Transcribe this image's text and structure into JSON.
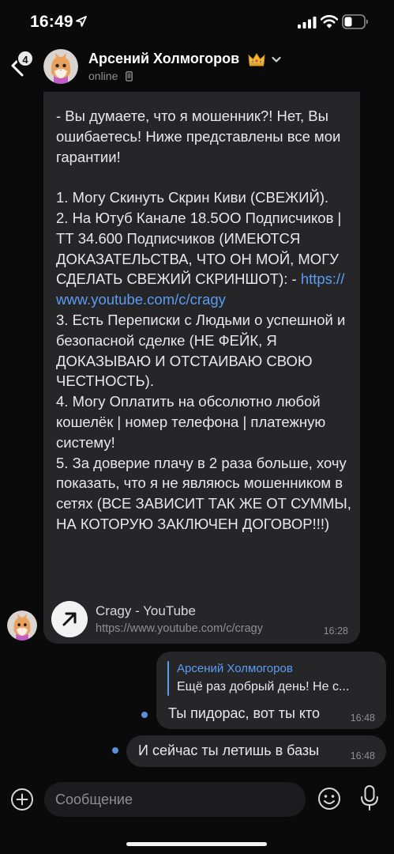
{
  "status_bar": {
    "time": "16:49"
  },
  "header": {
    "back_badge": "4",
    "contact_name": "Арсений Холмогоров",
    "status": "online"
  },
  "messages": {
    "incoming": {
      "text_before_link": "- Вы думаете, что я мошенник?! Нет, Вы ошибаетесь! Ниже представлены все мои гарантии!\n\n1. Могу Скинуть Скрин Киви (СВЕЖИЙ).\n2. На Ютуб Канале 18.5OO Подписчиков | ТТ 34.600 Подписчиков (ИМЕЮТСЯ ДОКАЗАТЕЛЬСТВА, ЧТО ОН МОЙ, МОГУ СДЕЛАТЬ СВЕЖИЙ СКРИНШОТ): - ",
      "link": "https://\nwww.youtube.com/c/cragy",
      "text_after_link": "\n3. Есть Переписки с Людьми о успешной и безопасной сделке (НЕ ФЕЙК, Я ДОКАЗЫВАЮ И ОТСТАИВАЮ СВОЮ ЧЕСТНОСТЬ).\n4. Могу Оплатить на обсолютно любой кошелёк | номер телефона | платежную систему!\n5. За доверие плачу в 2 раза больше, хочу показать, что я не являюсь мошенником в сетях (ВСЕ ЗАВИСИТ ТАК ЖЕ ОТ СУММЫ, НА КОТОРУЮ ЗАКЛЮЧЕН ДОГОВОР!!!)",
      "preview_title": "Cragy - YouTube",
      "preview_url": "https://www.youtube.com/c/cragy",
      "time": "16:28"
    },
    "outgoing_1": {
      "reply_author": "Арсений Холмогоров",
      "reply_text": "Ещё раз добрый день! Не с...",
      "text": "Ты пидорас, вот ты кто",
      "time": "16:48"
    },
    "outgoing_2": {
      "text": "И сейчас ты летишь в базы",
      "time": "16:48"
    }
  },
  "composer": {
    "placeholder": "Сообщение"
  },
  "colors": {
    "accent": "#5b9cf2",
    "bubble": "#262628",
    "background": "#0a0a0a"
  }
}
